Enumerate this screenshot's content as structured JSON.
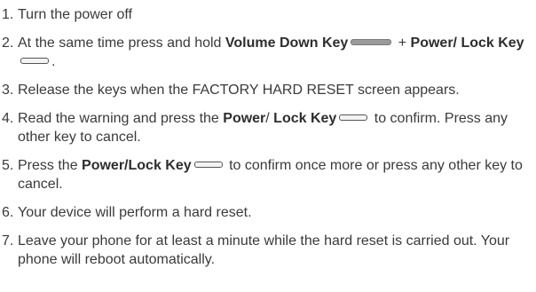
{
  "steps": [
    {
      "num": "1.",
      "parts": [
        {
          "t": "Turn the power off"
        }
      ]
    },
    {
      "num": "2.",
      "parts": [
        {
          "t": "At the same time press and hold "
        },
        {
          "t": "Volume Down Key",
          "b": true
        },
        {
          "icon": "volume-down-key-icon",
          "shape": "long"
        },
        {
          "t": " + "
        },
        {
          "t": "Power/ Lock Key",
          "b": true
        },
        {
          "icon": "power-lock-key-icon",
          "shape": "short"
        },
        {
          "t": "."
        }
      ]
    },
    {
      "num": "3.",
      "parts": [
        {
          "t": "Release the keys when the FACTORY HARD RESET screen appears."
        }
      ]
    },
    {
      "num": "4.",
      "parts": [
        {
          "t": "Read the warning and press the "
        },
        {
          "t": "Power",
          "b": true
        },
        {
          "t": "/ "
        },
        {
          "t": "Lock Key",
          "b": true
        },
        {
          "icon": "power-lock-key-icon",
          "shape": "short"
        },
        {
          "t": " to confirm. Press any other key to cancel."
        }
      ]
    },
    {
      "num": "5.",
      "parts": [
        {
          "t": "Press the "
        },
        {
          "t": "Power/Lock Key",
          "b": true
        },
        {
          "icon": "power-lock-key-icon",
          "shape": "short"
        },
        {
          "t": " to confirm once more or press any other key to cancel."
        }
      ]
    },
    {
      "num": "6.",
      "parts": [
        {
          "t": "Your device will perform a hard reset."
        }
      ]
    },
    {
      "num": "7.",
      "parts": [
        {
          "t": "Leave your phone for at least a minute while the hard reset is carried out. Your phone will reboot automatically."
        }
      ]
    }
  ]
}
